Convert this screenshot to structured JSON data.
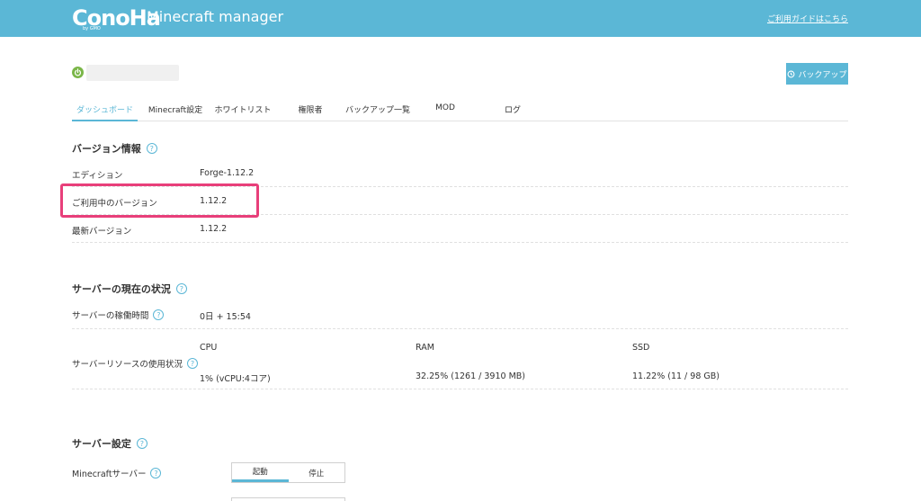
{
  "header": {
    "logo": "ConoHa",
    "logo_sub": "by GMO",
    "app_title": "Minecraft manager",
    "guide_link": "ご利用ガイドはこちら"
  },
  "server": {
    "status_icon": "power-icon",
    "status_color": "#7ab648"
  },
  "backup_button": "バックアップ",
  "tabs": [
    {
      "label": "ダッシュボード",
      "active": true
    },
    {
      "label": "Minecraft設定",
      "active": false
    },
    {
      "label": "ホワイトリスト",
      "active": false
    },
    {
      "label": "権限者",
      "active": false
    },
    {
      "label": "バックアップ一覧",
      "active": false
    },
    {
      "label": "MOD",
      "active": false
    },
    {
      "label": "ログ",
      "active": false
    }
  ],
  "version_info": {
    "title": "バージョン情報",
    "rows": [
      {
        "label": "エディション",
        "value": "Forge-1.12.2"
      },
      {
        "label": "ご利用中のバージョン",
        "value": "1.12.2"
      },
      {
        "label": "最新バージョン",
        "value": "1.12.2"
      }
    ]
  },
  "server_status": {
    "title": "サーバーの現在の状況",
    "uptime_label": "サーバーの稼働時間",
    "uptime_value": "0日 + 15:54",
    "resource_label": "サーバーリソースの使用状況",
    "resources": [
      {
        "name": "CPU",
        "value": "1% (vCPU:4コア)"
      },
      {
        "name": "RAM",
        "value": "32.25% (1261 / 3910 MB)"
      },
      {
        "name": "SSD",
        "value": "11.22% (11 / 98 GB)"
      }
    ]
  },
  "server_settings": {
    "title": "サーバー設定",
    "minecraft_label": "Minecraftサーバー",
    "start_label": "起動",
    "stop_label": "停止",
    "selected": "起動"
  },
  "colors": {
    "accent": "#5bb7d6",
    "highlight": "#e83f7a",
    "status_green": "#7ab648"
  }
}
